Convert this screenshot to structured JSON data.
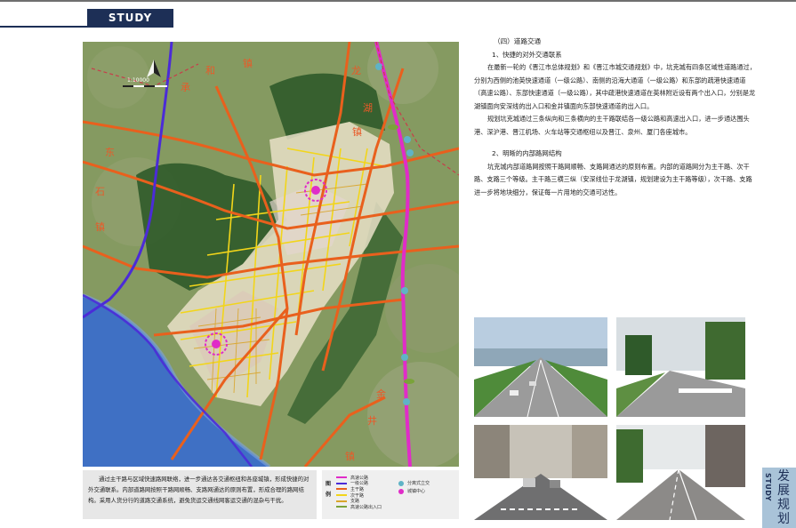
{
  "header": {
    "tab_label": "STUDY"
  },
  "map": {
    "scale_text": "1:10000",
    "road_colors": {
      "expressway": "#e02cc8",
      "primary_highway": "#4b2bd8",
      "main_road": "#e9601d",
      "secondary_road": "#f2d51a",
      "branch_road": "#d9a52a",
      "gateway": "#7aa33a"
    },
    "labels": [
      {
        "id": "he",
        "text": "和"
      },
      {
        "id": "zhen1",
        "text": "镇"
      },
      {
        "id": "cheng",
        "text": "承"
      },
      {
        "id": "dong",
        "text": "东"
      },
      {
        "id": "shi",
        "text": "石"
      },
      {
        "id": "long",
        "text": "龙"
      },
      {
        "id": "hu",
        "text": "湖"
      },
      {
        "id": "jin",
        "text": "金"
      },
      {
        "id": "jing",
        "text": "井"
      },
      {
        "id": "zhen2",
        "text": "镇"
      },
      {
        "id": "zhen3",
        "text": "镇"
      },
      {
        "id": "zhen4",
        "text": "镇"
      }
    ]
  },
  "caption": {
    "text": "通过主干路与区域快速路网联络，进一步通达各交通枢纽和各座城镇，形成快捷的对外交通联系。内部道路网按照干路网顺畅、支路网通达的原则布置，形成合理的路网结构。采用人货分行的道路交通系统，避免货运交通线网客运交通的混杂与干扰。"
  },
  "legend": {
    "key_label": "图例",
    "items": [
      {
        "label": "高速公路",
        "color": "#e02cc8"
      },
      {
        "label": "一级公路",
        "color": "#4b2bd8"
      },
      {
        "label": "主干路",
        "color": "#e9601d"
      },
      {
        "label": "次干路",
        "color": "#f2d51a"
      },
      {
        "label": "支路",
        "color": "#d9a52a"
      },
      {
        "label": "高速公路出入口",
        "color": "#7aa33a"
      }
    ],
    "items2": [
      {
        "label": "分离式立交",
        "color": "#5fb3c6"
      },
      {
        "label": "城镇中心",
        "color": "#e02cc8"
      }
    ]
  },
  "article": {
    "section_title": "（四）道路交通",
    "sub1": "1、快捷的对外交通联系",
    "para1": "在最新一轮的《晋江市总体规划》和《晋江市城交通规划》中，坑克城有四条区域性道路通过，分别为西侧的池英快速通道（一级公路）、南侧的沿海大通道（一级公路）和东部的疏港快速通道（高速公路）、东部快速通道（一级公路），其中疏港快速通道在英林附近设有两个出入口，分别是龙湖镇面向安深线的出入口和金井镇面向东部快速通道的出入口。",
    "para2": "规划坑克城通过三条纵向和三条横向的主干路联结各一级公路和高速出入口，进一步通达围头港、深沪港、晋江机场、火车站等交通枢纽以及晋江、泉州、厦门各座城市。",
    "sub2": "2、明晰的内部路网结构",
    "para3": "坑克城内部道路网按照干路网顺畅、支路网通达的原则布置。内部的道路网分为主干路、次干路、支路三个等级。主干路三横三纵（安深线位于龙湖镇，规划建设为主干路等级），次干路、支路进一步将地块细分，保证每一片用地的交通可达性。"
  },
  "side": {
    "en": "STUDY",
    "zh": "发展规划"
  }
}
